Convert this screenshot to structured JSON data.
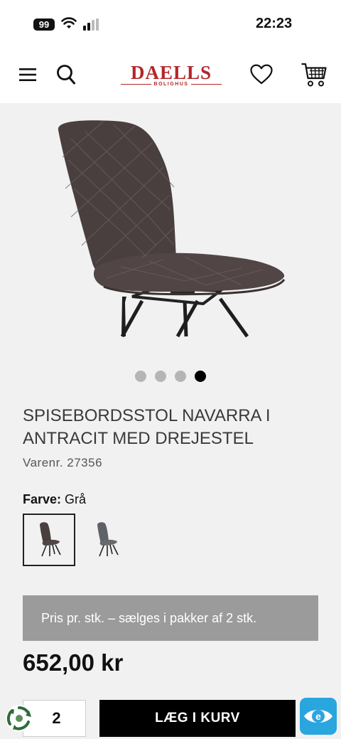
{
  "status_bar": {
    "battery": "99",
    "time": "22:23"
  },
  "header": {
    "logo_main": "DAELLS",
    "logo_sub": "BOLIGHUS",
    "icons": [
      "menu-icon",
      "search-icon",
      "heart-icon",
      "cart-icon"
    ],
    "brand_color": "#b3262b"
  },
  "gallery": {
    "image_count": 4,
    "active_index": 3
  },
  "product": {
    "title": "SPISEBORDSSTOL NAVARRA I ANTRACIT MED DREJESTEL",
    "sku": "Varenr. 27356",
    "color_label": "Farve:",
    "color_value": "Grå",
    "variants": [
      "selected",
      "other"
    ],
    "pack_note": "Pris pr. stk. – sælges i pakker af 2 stk.",
    "price": "652,00 kr"
  },
  "purchase": {
    "quantity": "2",
    "add_to_cart_label": "LÆG I KURV"
  },
  "badges": [
    "recycle-icon",
    "e-maerket-icon"
  ]
}
